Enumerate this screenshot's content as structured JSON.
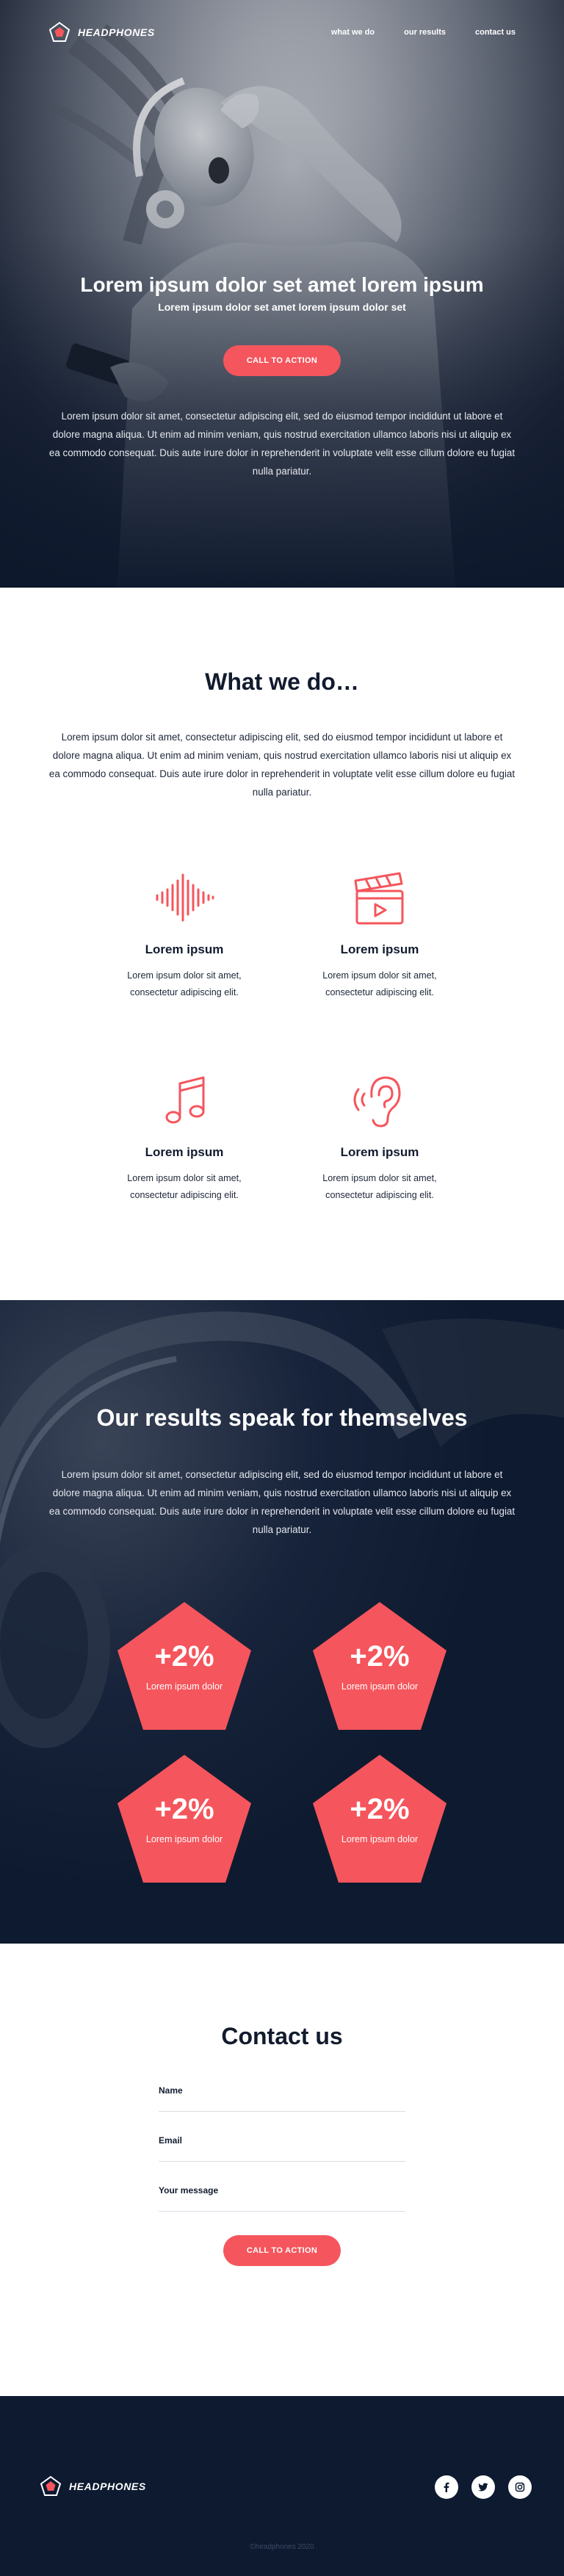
{
  "brand": {
    "name": "Headphones",
    "accent": "#f5555c",
    "dark": "#0d1a30"
  },
  "nav": {
    "links": [
      "what we do",
      "our results",
      "contact us"
    ]
  },
  "hero": {
    "title": "Lorem ipsum dolor set amet lorem ipsum",
    "subtitle": "Lorem ipsum dolor set amet lorem ipsum dolor set",
    "cta": "CALL TO ACTION",
    "body": "Lorem ipsum dolor sit amet, consectetur adipiscing elit, sed do eiusmod tempor incididunt ut labore et dolore magna aliqua. Ut enim ad minim veniam, quis nostrud exercitation ullamco laboris nisi ut aliquip ex ea commodo consequat. Duis aute irure dolor in reprehenderit in voluptate velit esse cillum dolore eu fugiat nulla pariatur."
  },
  "what": {
    "title": "What we do…",
    "body": "Lorem ipsum dolor sit amet, consectetur adipiscing elit, sed do eiusmod tempor incididunt ut labore et dolore magna aliqua. Ut enim ad minim veniam, quis nostrud exercitation ullamco laboris nisi ut aliquip ex ea commodo consequat. Duis aute irure dolor in reprehenderit in voluptate velit esse cillum dolore eu fugiat nulla pariatur.",
    "features": [
      {
        "icon": "sound-wave-icon",
        "title": "Lorem ipsum",
        "text": "Lorem ipsum dolor sit amet, consectetur adipiscing elit."
      },
      {
        "icon": "clapperboard-icon",
        "title": "Lorem ipsum",
        "text": "Lorem ipsum dolor sit amet, consectetur adipiscing elit."
      },
      {
        "icon": "music-note-icon",
        "title": "Lorem ipsum",
        "text": "Lorem ipsum dolor sit amet, consectetur adipiscing elit."
      },
      {
        "icon": "ear-icon",
        "title": "Lorem ipsum",
        "text": "Lorem ipsum dolor sit amet, consectetur adipiscing elit."
      }
    ]
  },
  "results": {
    "title": "Our results speak for themselves",
    "body": "Lorem ipsum dolor sit amet, consectetur adipiscing elit, sed do eiusmod tempor incididunt ut labore et dolore magna aliqua. Ut enim ad minim veniam, quis nostrud exercitation ullamco laboris nisi ut aliquip ex ea commodo consequat. Duis aute irure dolor in reprehenderit in voluptate velit esse cillum dolore eu fugiat nulla pariatur.",
    "stats": [
      {
        "value": "+2%",
        "label": "Lorem ipsum dolor"
      },
      {
        "value": "+2%",
        "label": "Lorem ipsum dolor"
      },
      {
        "value": "+2%",
        "label": "Lorem ipsum dolor"
      },
      {
        "value": "+2%",
        "label": "Lorem ipsum dolor"
      }
    ]
  },
  "contact": {
    "title": "Contact us",
    "fields": {
      "name": "Name",
      "email": "Email",
      "message": "Your message"
    },
    "cta": "CALL TO ACTION"
  },
  "footer": {
    "socials": [
      "facebook-icon",
      "twitter-icon",
      "instagram-icon"
    ],
    "copyright": "©headphones 2020"
  }
}
